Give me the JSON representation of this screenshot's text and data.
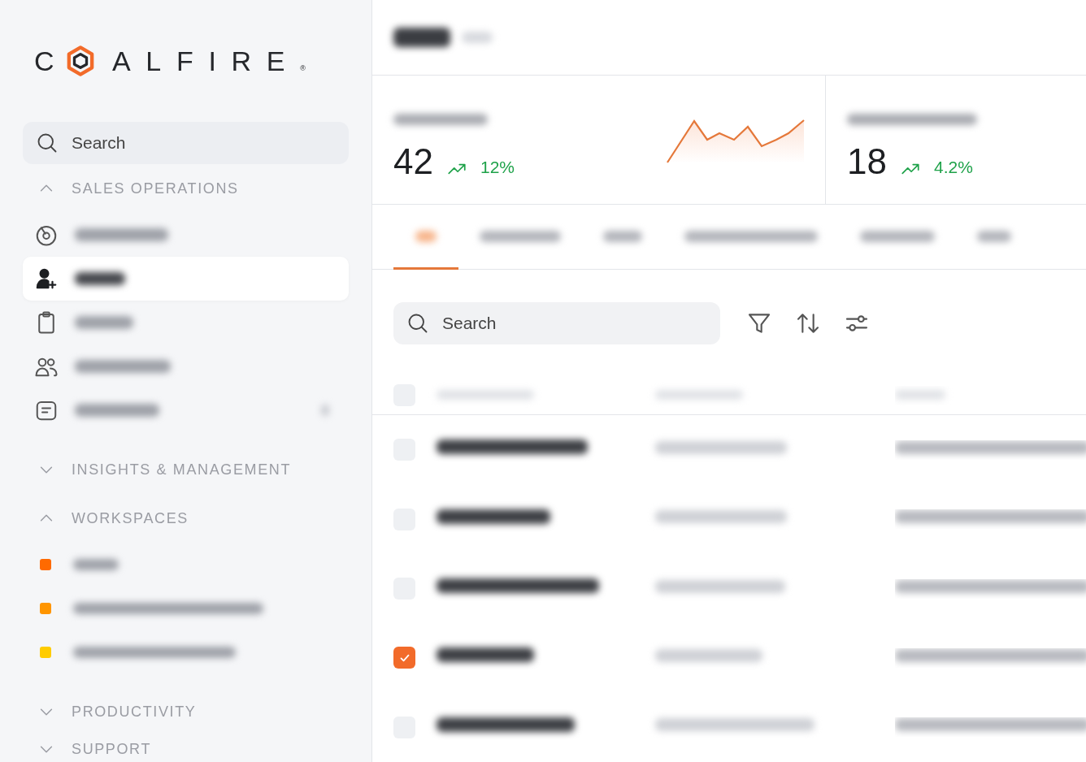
{
  "logo": {
    "before_mark": "C",
    "after_mark": "ALFIRE",
    "registered": "®"
  },
  "sidebar": {
    "search": {
      "placeholder": "Search"
    },
    "sections": [
      {
        "title": "SALES OPERATIONS",
        "expanded": true,
        "items": [
          {
            "kind": "dashboard",
            "selected": false
          },
          {
            "kind": "person-add",
            "selected": true
          },
          {
            "kind": "clipboard",
            "selected": false
          },
          {
            "kind": "people",
            "selected": false
          },
          {
            "kind": "message",
            "selected": false,
            "badge": true
          }
        ]
      },
      {
        "title": "INSIGHTS & MANAGEMENT",
        "expanded": false
      },
      {
        "title": "WORKSPACES",
        "expanded": true,
        "items": [
          {
            "color": "#ff6a00"
          },
          {
            "color": "#ff9500"
          },
          {
            "color": "#ffcc00"
          }
        ]
      },
      {
        "title": "PRODUCTIVITY",
        "expanded": false
      },
      {
        "title": "SUPPORT",
        "expanded": false
      }
    ]
  },
  "kpis": [
    {
      "value": "42",
      "change": "12%",
      "sparkline": true
    },
    {
      "value": "18",
      "change": "4.2%",
      "sparkline": false
    }
  ],
  "tabs": [
    {
      "selected": true
    },
    {
      "selected": false
    },
    {
      "selected": false
    },
    {
      "selected": false
    },
    {
      "selected": false
    },
    {
      "selected": false
    }
  ],
  "toolbar": {
    "search": {
      "placeholder": "Search"
    },
    "tools": [
      {
        "kind": "filter"
      },
      {
        "kind": "sort"
      },
      {
        "kind": "sliders"
      }
    ]
  },
  "table": {
    "header_checked": false,
    "rows": [
      {
        "selected": false
      },
      {
        "selected": false
      },
      {
        "selected": false
      },
      {
        "selected": true
      },
      {
        "selected": false
      }
    ]
  }
}
